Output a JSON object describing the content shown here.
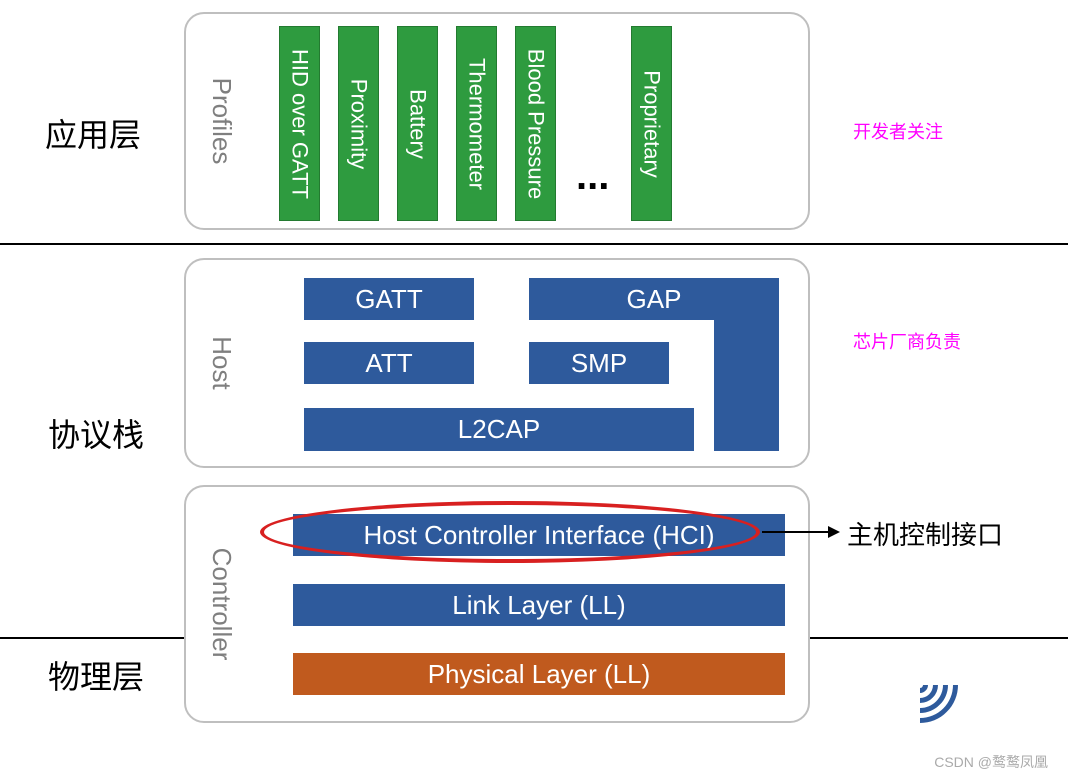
{
  "layers": {
    "application": "应用层",
    "protocol": "协议栈",
    "physical": "物理层"
  },
  "notes": {
    "developer": "开发者关注",
    "vendor": "芯片厂商负责",
    "hci_desc": "主机控制接口"
  },
  "panels": {
    "profiles_label": "Profiles",
    "host_label": "Host",
    "controller_label": "Controller"
  },
  "profiles": {
    "p1": "HID over GATT",
    "p2": "Proximity",
    "p3": "Battery",
    "p4": "Thermometer",
    "p5": "Blood Pressure",
    "p6": "Proprietary",
    "ellipsis": "..."
  },
  "host": {
    "gatt": "GATT",
    "gap": "GAP",
    "att": "ATT",
    "smp": "SMP",
    "l2cap": "L2CAP"
  },
  "controller": {
    "hci": "Host Controller Interface (HCI)",
    "ll": "Link  Layer (LL)",
    "phy": "Physical  Layer (LL)"
  },
  "watermark": "CSDN @鹜鹜凤凰"
}
